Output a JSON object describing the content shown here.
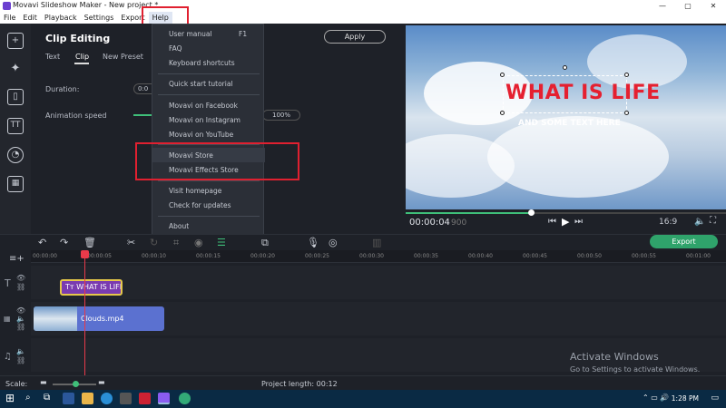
{
  "window": {
    "title": "Movavi Slideshow Maker - New project *",
    "controls": [
      "—",
      "▢",
      "✕"
    ]
  },
  "menubar": {
    "items": [
      "File",
      "Edit",
      "Playback",
      "Settings",
      "Export",
      "Help"
    ]
  },
  "sidebar": {
    "icons": [
      "import-icon",
      "magic-wand-icon",
      "filter-icon",
      "titles-icon",
      "stickers-icon",
      "more-tools-icon"
    ]
  },
  "panel": {
    "title": "Clip Editing",
    "apply_label": "Apply",
    "tabs": [
      "Text",
      "Clip",
      "New Preset"
    ],
    "duration_label": "Duration:",
    "duration_value": "0:0",
    "speed_label": "Animation speed",
    "speed_value": "100%"
  },
  "help_menu": {
    "items": [
      {
        "label": "User manual",
        "shortcut": "F1"
      },
      {
        "label": "FAQ"
      },
      {
        "label": "Keyboard shortcuts"
      },
      {
        "label": "Quick start tutorial"
      },
      {
        "label": "Movavi on Facebook"
      },
      {
        "label": "Movavi on Instagram"
      },
      {
        "label": "Movavi on YouTube"
      },
      {
        "label": "Movavi Store"
      },
      {
        "label": "Movavi Effects Store"
      },
      {
        "label": "Visit homepage"
      },
      {
        "label": "Check for updates"
      },
      {
        "label": "About"
      }
    ]
  },
  "preview": {
    "title_text": "WHAT IS LIFE",
    "subtitle_text": "AND SOME TEXT HERE",
    "time_current": "00:00:04",
    "time_ms": "900",
    "aspect": "16:9",
    "progress": 0.39
  },
  "toolbar": {
    "export_label": "Export"
  },
  "timeline": {
    "ticks": [
      "00:00:00",
      "00:00:05",
      "00:00:10",
      "00:00:15",
      "00:00:20",
      "00:00:25",
      "00:00:30",
      "00:00:35",
      "00:00:40",
      "00:00:45",
      "00:00:50",
      "00:00:55",
      "00:01:00"
    ],
    "title_clip": "WHAT IS LIFE",
    "video_clip": "Clouds.mp4"
  },
  "status": {
    "scale_label": "Scale:",
    "project_length": "Project length:  00:12"
  },
  "watermark": {
    "line1": "Activate Windows",
    "line2": "Go to Settings to activate Windows."
  },
  "taskbar": {
    "time": "1:28 PM"
  }
}
